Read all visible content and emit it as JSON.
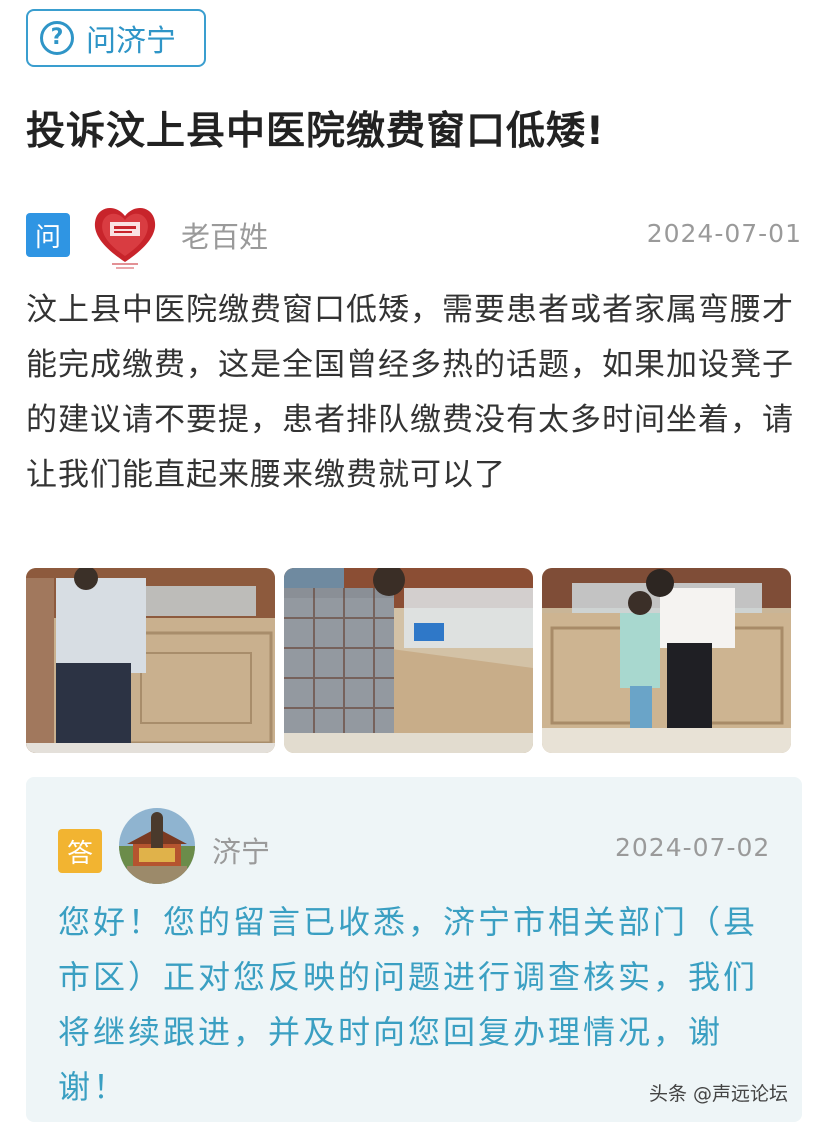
{
  "header": {
    "tag_label": "问济宁",
    "tag_icon": "question-circle-icon",
    "title": "投诉汶上县中医院缴费窗口低矮!"
  },
  "question": {
    "badge": "问",
    "user": "老百姓",
    "date": "2024-07-01",
    "avatar_icon": "heart-justice-avatar",
    "text": "汶上县中医院缴费窗口低矮，需要患者或者家属弯腰才能完成缴费，这是全国曾经多热的话题，如果加设凳子的建议请不要提，患者排队缴费没有太多时间坐着，请让我们能直起来腰来缴费就可以了",
    "photos": [
      {
        "name": "photo-payment-counter-1"
      },
      {
        "name": "photo-payment-counter-2"
      },
      {
        "name": "photo-payment-counter-3"
      }
    ]
  },
  "answer": {
    "badge": "答",
    "user": "济宁",
    "date": "2024-07-02",
    "avatar_icon": "temple-avatar",
    "text": "您好！您的留言已收悉，济宁市相关部门（县市区）正对您反映的问题进行调查核实，我们将继续跟进，并及时向您回复办理情况，谢谢！"
  },
  "watermark": "头条 @声远论坛",
  "colors": {
    "accent_blue": "#2f95c7",
    "question_badge": "#2f95e3",
    "answer_badge": "#f2b431",
    "answer_text": "#3a9fc2",
    "answer_bg": "#eef5f7"
  }
}
